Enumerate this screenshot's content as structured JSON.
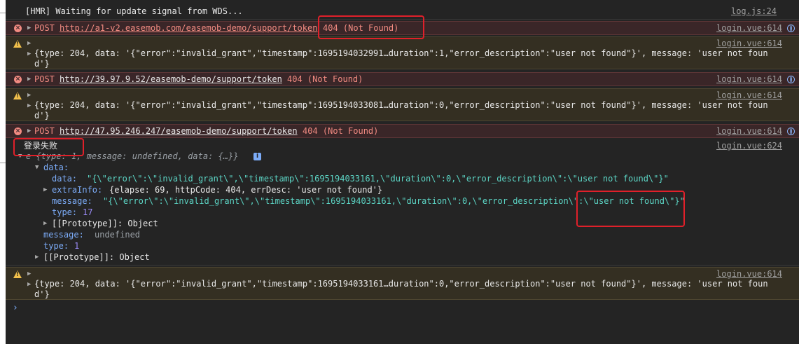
{
  "hmr": {
    "text": "[HMR] Waiting for update signal from WDS...",
    "source": "log.js:24"
  },
  "post1": {
    "method": "POST",
    "url": "http://a1-v2.easemob.com/easemob-demo/support/token",
    "status": "404 (Not Found)",
    "source": "login.vue:614"
  },
  "warn1": {
    "source": "login.vue:614",
    "line1": "{type: 204, data: '{\"error\":\"invalid_grant\",\"timestamp\":1695194032991…duration\":1,\"error_description\":\"user not found\"}', message: 'user not foun",
    "line2": "d'}"
  },
  "post2": {
    "method": "POST",
    "url": "http://39.97.9.52/easemob-demo/support/token",
    "status": "404 (Not Found)",
    "source": "login.vue:614"
  },
  "warn2": {
    "source": "login.vue:614",
    "line1": "{type: 204, data: '{\"error\":\"invalid_grant\",\"timestamp\":1695194033081…duration\":0,\"error_description\":\"user not found\"}', message: 'user not foun",
    "line2": "d'}"
  },
  "post3": {
    "method": "POST",
    "url": "http://47.95.246.247/easemob-demo/support/token",
    "status": "404 (Not Found)",
    "source": "login.vue:614"
  },
  "login_fail": {
    "text": "登录失败",
    "source": "login.vue:624"
  },
  "obj": {
    "summary": "e {type: 1, message: undefined, data: {…}}",
    "data_key": "data:",
    "data_data_key": "data:",
    "data_data_val": "\"{\\\"error\\\":\\\"invalid_grant\\\",\\\"timestamp\\\":1695194033161,\\\"duration\\\":0,\\\"error_description\\\":\\\"user not found\\\"}\"",
    "extra_key": "extraInfo:",
    "extra_val": "{elapse: 69, httpCode: 404, errDesc: 'user not found'}",
    "message_key": "message:",
    "message_val": "\"{\\\"error\\\":\\\"invalid_grant\\\",\\\"timestamp\\\":1695194033161,\\\"duration\\\":0,\\\"error_description\\\":\\\"user not found\\\"}\"",
    "type_key": "type:",
    "type_val": "17",
    "proto1": "[[Prototype]]: Object",
    "msg_key": "message:",
    "msg_val": "undefined",
    "t_key": "type:",
    "t_val": "1",
    "proto2": "[[Prototype]]: Object"
  },
  "warn3": {
    "source": "login.vue:614",
    "line1": "{type: 204, data: '{\"error\":\"invalid_grant\",\"timestamp\":1695194033161…duration\":0,\"error_description\":\"user not found\"}', message: 'user not foun",
    "line2": "d'}"
  },
  "prompt": "›",
  "colors": {
    "bg": "#242424",
    "error": "#f28b82",
    "warning_bg": "#342f22",
    "error_bg": "#3a2628",
    "highlight_box": "#e0202a"
  }
}
